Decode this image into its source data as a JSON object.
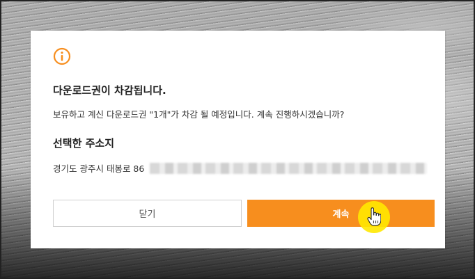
{
  "dialog": {
    "title": "다운로드권이 차감됩니다.",
    "description": "보유하고 계신 다운로드권 \"1개\"가 차감 될 예정입니다. 계속 진행하시겠습니까?",
    "address_heading": "선택한 주소지",
    "address_text": "경기도 광주시 태봉로 86",
    "close_label": "닫기",
    "continue_label": "계속"
  },
  "icons": {
    "info": "info-icon",
    "cursor": "hand-pointer-icon"
  },
  "colors": {
    "accent": "#f78e1e",
    "cursor_highlight": "#ffe800"
  }
}
